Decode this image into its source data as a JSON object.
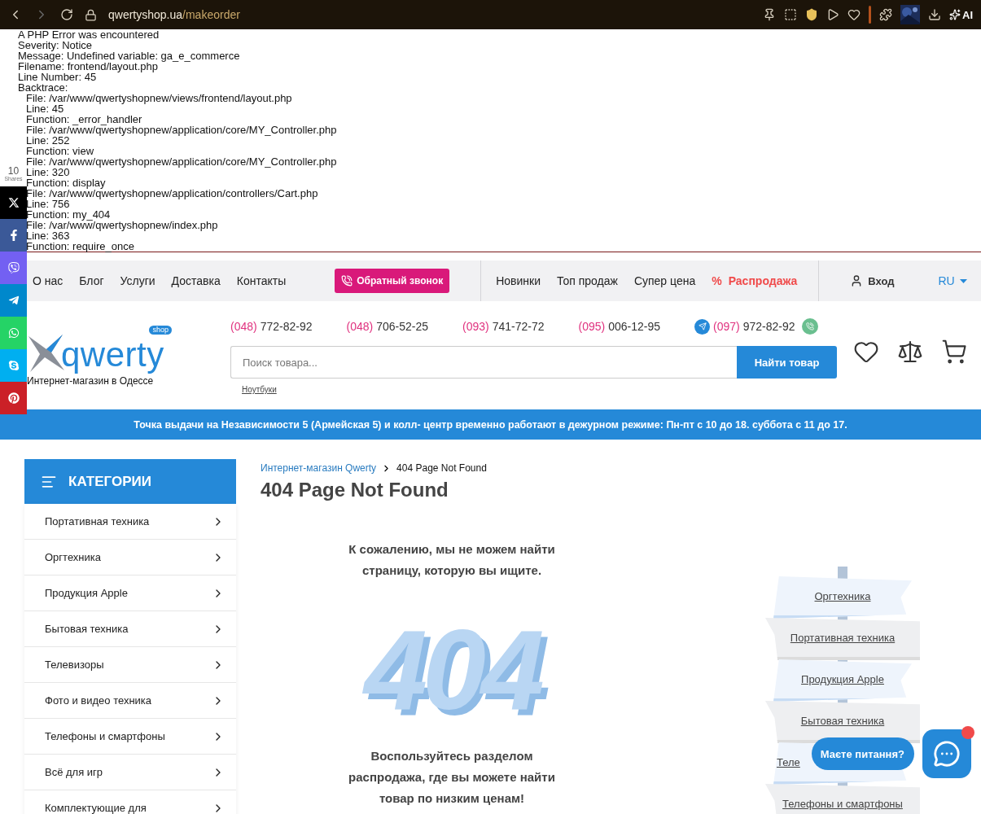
{
  "browser": {
    "host": "qwertyshop.ua",
    "path": "/makeorder",
    "ai_label": "AI"
  },
  "error": {
    "lines": [
      "A PHP Error was encountered",
      "Severity: Notice",
      "Message: Undefined variable: ga_e_commerce",
      "Filename: frontend/layout.php",
      "Line Number: 45",
      "Backtrace:"
    ],
    "backtrace": [
      "File: /var/www/qwertyshopnew/views/frontend/layout.php",
      "Line: 45",
      "Function: _error_handler",
      "File: /var/www/qwertyshopnew/application/core/MY_Controller.php",
      "Line: 252",
      "Function: view",
      "File: /var/www/qwertyshopnew/application/core/MY_Controller.php",
      "Line: 320",
      "Function: display",
      "File: /var/www/qwertyshopnew/application/controllers/Cart.php",
      "Line: 756",
      "Function: my_404",
      "File: /var/www/qwertyshopnew/index.php",
      "Line: 363",
      "Function: require_once"
    ]
  },
  "share": {
    "count": "10",
    "label": "Shares",
    "buttons": [
      {
        "kind": "x"
      },
      {
        "kind": "facebook"
      },
      {
        "kind": "viber"
      },
      {
        "kind": "telegram"
      },
      {
        "kind": "whatsapp"
      },
      {
        "kind": "skype"
      },
      {
        "kind": "pinterest"
      }
    ]
  },
  "nav": {
    "links": [
      "О нас",
      "Блог",
      "Услуги",
      "Доставка",
      "Контакты"
    ],
    "callback": "Обратный звонок",
    "links2": [
      "Новинки",
      "Топ продаж",
      "Супер цена"
    ],
    "sale_icon": "%",
    "sale": "Распродажа",
    "login": "Вход",
    "lang": "RU"
  },
  "header": {
    "logo_word": "qwerty",
    "logo_badge": "shop",
    "tagline": "Интернет-магазин в Одессе",
    "phones": [
      {
        "code": "(048)",
        "number": "772-82-92",
        "kind": "plain"
      },
      {
        "code": "(048)",
        "number": "706-52-25",
        "kind": "plain"
      },
      {
        "code": "(093)",
        "number": "741-72-72",
        "kind": "plain"
      },
      {
        "code": "(095)",
        "number": "006-12-95",
        "kind": "plain"
      },
      {
        "code": "(097)",
        "number": "972-82-92",
        "kind": "messengers"
      }
    ],
    "search": {
      "placeholder": "Поиск товара...",
      "button": "Найти товар",
      "hint": "Ноутбуки"
    }
  },
  "banner": "Точка выдачи на Независимости 5 (Армейская 5) и колл- центр временно работают в дежурном режиме: Пн-пт с 10 до 18. суббота с 11 до 17.",
  "categories": {
    "title": "КАТЕГОРИИ",
    "items": [
      "Портативная техника",
      "Оргтехника",
      "Продукция Apple",
      "Бытовая техника",
      "Телевизоры",
      "Фото и видео техника",
      "Телефоны и смартфоны",
      "Всё для игр",
      "Комплектующие для"
    ]
  },
  "breadcrumbs": [
    {
      "label": "Интернет-магазин Qwerty",
      "link": true
    },
    {
      "label": "404 Page Not Found",
      "link": false
    }
  ],
  "title": "404 Page Not Found",
  "message": "К сожалению, мы не можем найти страницу, которую вы ищите.",
  "illustration": "404",
  "hint": "Воспользуйтесь разделом распродажа, где вы можете найти товар по низким ценам!",
  "signposts": [
    {
      "label": "Оргтехника",
      "kind": "right",
      "color": "#eef4fc",
      "partial": false
    },
    {
      "label": "Портативная техника",
      "kind": "left",
      "color": "#eeeff1",
      "partial": false
    },
    {
      "label": "Продукция Apple",
      "kind": "right",
      "color": "#eef4fc",
      "partial": false
    },
    {
      "label": "Бытовая техника",
      "kind": "left",
      "color": "#eeeff1",
      "partial": false
    },
    {
      "label": "Теле",
      "kind": "right",
      "color": "#eef4fc",
      "partial": true
    },
    {
      "label": "Телефоны и смартфоны",
      "kind": "left",
      "color": "#eeeff1",
      "partial": false
    }
  ],
  "chat": {
    "label": "Маєте питання?",
    "unread": true
  }
}
